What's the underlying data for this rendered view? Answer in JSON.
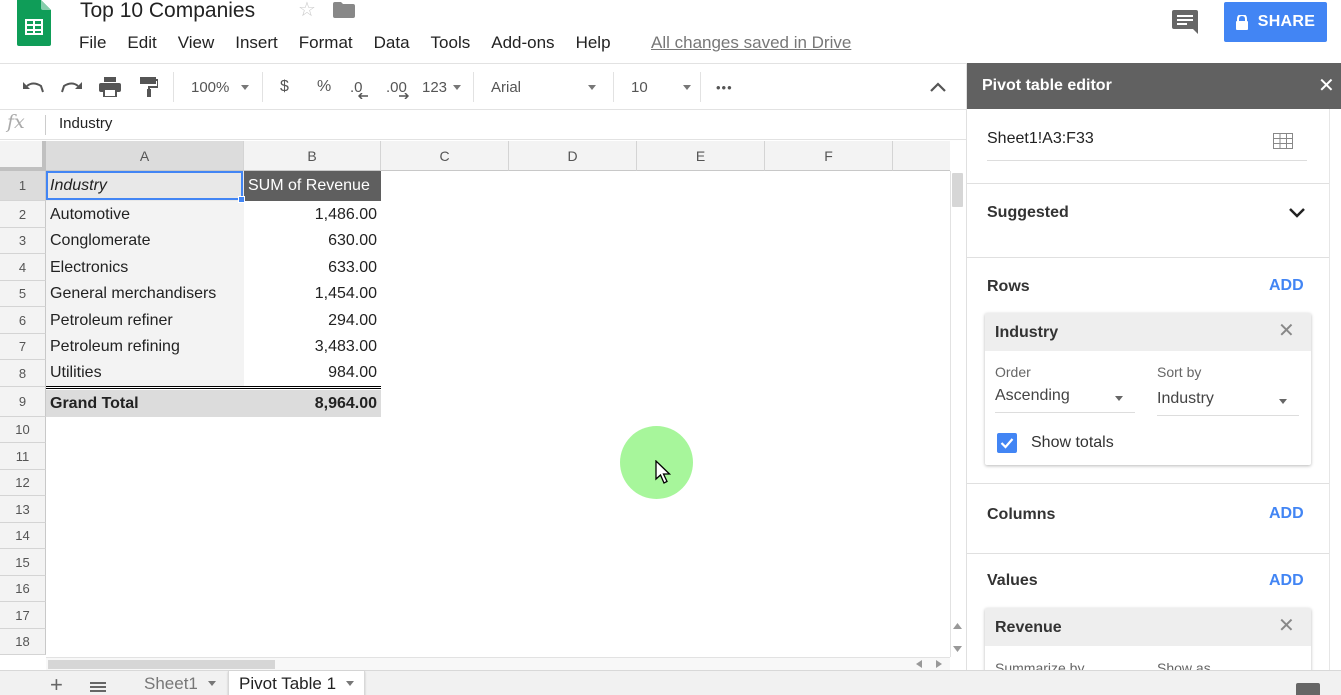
{
  "app": {
    "title": "Top 10 Companies",
    "menu": [
      "File",
      "Edit",
      "View",
      "Insert",
      "Format",
      "Data",
      "Tools",
      "Add-ons",
      "Help"
    ],
    "saved_status": "All changes saved in Drive",
    "share_label": "SHARE",
    "colors": {
      "brand_green": "#0f9d58",
      "accent_blue": "#4285f4",
      "header_dark": "#616161"
    }
  },
  "toolbar": {
    "zoom": "100%",
    "currency": "$",
    "percent": "%",
    "decrease_decimal": ".0",
    "increase_decimal": ".00",
    "more_formats": "123",
    "font": "Arial",
    "font_size": "10",
    "more": "•••",
    "icons": [
      "undo-icon",
      "redo-icon",
      "print-icon",
      "paint-format-icon",
      "collapse-icon"
    ]
  },
  "formula_bar": {
    "fx": "fx",
    "value": "Industry"
  },
  "grid": {
    "columns": [
      "A",
      "B",
      "C",
      "D",
      "E",
      "F"
    ],
    "rows": [
      "1",
      "2",
      "3",
      "4",
      "5",
      "6",
      "7",
      "8",
      "9",
      "10",
      "11",
      "12",
      "13",
      "14",
      "15",
      "16",
      "17",
      "18"
    ],
    "header": {
      "a": "Industry",
      "b": "SUM of Revenue"
    },
    "data": [
      {
        "industry": "Automotive",
        "revenue": "1,486.00"
      },
      {
        "industry": "Conglomerate",
        "revenue": "630.00"
      },
      {
        "industry": "Electronics",
        "revenue": "633.00"
      },
      {
        "industry": "General merchandisers",
        "revenue": "1,454.00"
      },
      {
        "industry": "Petroleum refiner",
        "revenue": "294.00"
      },
      {
        "industry": "Petroleum refining",
        "revenue": "3,483.00"
      },
      {
        "industry": "Utilities",
        "revenue": "984.00"
      }
    ],
    "total": {
      "label": "Grand Total",
      "value": "8,964.00"
    }
  },
  "sheets": {
    "add": "+",
    "tabs": [
      {
        "name": "Sheet1",
        "active": false
      },
      {
        "name": "Pivot Table 1",
        "active": true
      }
    ]
  },
  "pivot_editor": {
    "title": "Pivot table editor",
    "close": "✕",
    "range": "Sheet1!A3:F33",
    "suggested": "Suggested",
    "rows_label": "Rows",
    "columns_label": "Columns",
    "values_label": "Values",
    "add_label": "ADD",
    "rows_card": {
      "title": "Industry",
      "order_label": "Order",
      "order_value": "Ascending",
      "sort_label": "Sort by",
      "sort_value": "Industry",
      "show_totals": "Show totals"
    },
    "values_card": {
      "title": "Revenue",
      "summarize_label": "Summarize by",
      "show_as_label": "Show as"
    }
  }
}
